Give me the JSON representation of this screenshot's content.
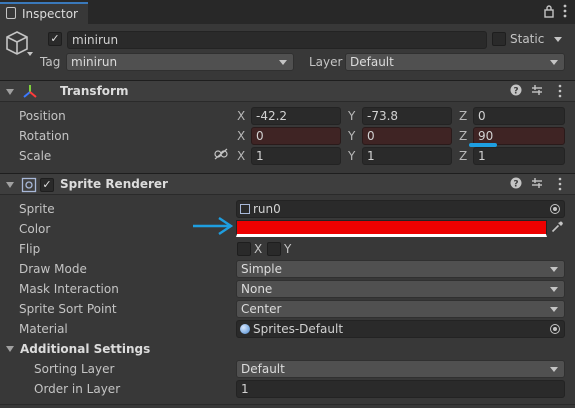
{
  "window": {
    "tab_label": "Inspector",
    "lock_icon": "lock-icon",
    "menu_icon": "kebab-menu-icon"
  },
  "gameobject": {
    "active": true,
    "name": "minirun",
    "static_label": "Static",
    "tag_label": "Tag",
    "tag_value": "minirun",
    "layer_label": "Layer",
    "layer_value": "Default"
  },
  "transform": {
    "title": "Transform",
    "position": {
      "label": "Position",
      "x": "-42.2",
      "y": "-73.8",
      "z": "0"
    },
    "rotation": {
      "label": "Rotation",
      "x": "0",
      "y": "0",
      "z": "90"
    },
    "scale": {
      "label": "Scale",
      "x": "1",
      "y": "1",
      "z": "1"
    },
    "axis": {
      "x": "X",
      "y": "Y",
      "z": "Z"
    }
  },
  "sprite_renderer": {
    "title": "Sprite Renderer",
    "enabled": true,
    "sprite": {
      "label": "Sprite",
      "value": "run0"
    },
    "color": {
      "label": "Color",
      "value": "#ee0000"
    },
    "flip": {
      "label": "Flip",
      "x": "X",
      "y": "Y"
    },
    "draw_mode": {
      "label": "Draw Mode",
      "value": "Simple"
    },
    "mask_interaction": {
      "label": "Mask Interaction",
      "value": "None"
    },
    "sort_point": {
      "label": "Sprite Sort Point",
      "value": "Center"
    },
    "material": {
      "label": "Material",
      "value": "Sprites-Default"
    },
    "additional": {
      "label": "Additional Settings",
      "sorting_layer_label": "Sorting Layer",
      "sorting_layer_value": "Default",
      "order_label": "Order in Layer",
      "order_value": "1"
    }
  },
  "annotations": {
    "arrow_color": "#1e9ee0",
    "underline_color": "#1e9ee0"
  }
}
